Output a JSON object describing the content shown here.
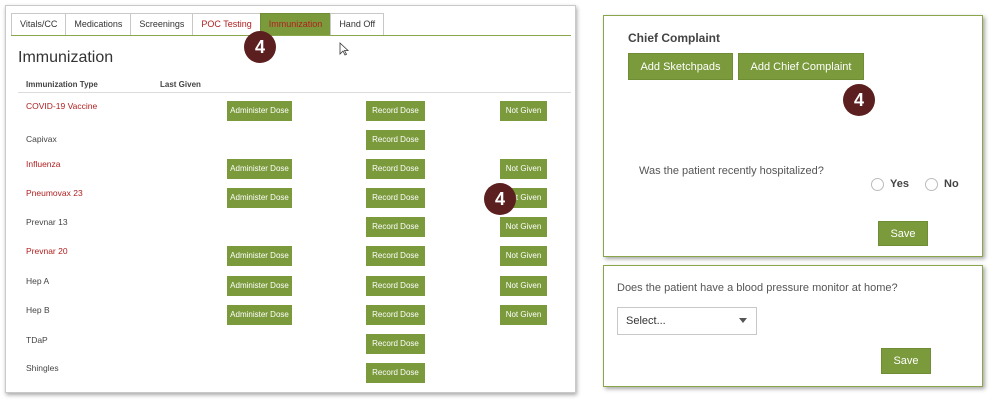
{
  "left": {
    "tabs": [
      "Vitals/CC",
      "Medications",
      "Screenings",
      "POC Testing",
      "Immunization",
      "Hand Off"
    ],
    "heading": "Immunization",
    "col_type": "Immunization Type",
    "col_last": "Last Given",
    "rows": [
      {
        "name": "COVID-19 Vaccine",
        "administer": "Administer Dose",
        "record": "Record Dose",
        "not_given": "Not Given"
      },
      {
        "name": "Capivax",
        "record": "Record Dose"
      },
      {
        "name": "Influenza",
        "administer": "Administer Dose",
        "record": "Record Dose",
        "not_given": "Not Given"
      },
      {
        "name": "Pneumovax 23",
        "administer": "Administer Dose",
        "record": "Record Dose",
        "not_given": "Not Given"
      },
      {
        "name": "Prevnar 13",
        "record": "Record Dose",
        "not_given": "Not Given"
      },
      {
        "name": "Prevnar 20",
        "administer": "Administer Dose",
        "record": "Record Dose",
        "not_given": "Not Given"
      },
      {
        "name": "Hep A",
        "administer": "Administer Dose",
        "record": "Record Dose",
        "not_given": "Not Given"
      },
      {
        "name": "Hep B",
        "administer": "Administer Dose",
        "record": "Record Dose",
        "not_given": "Not Given"
      },
      {
        "name": "TDaP",
        "record": "Record Dose"
      },
      {
        "name": "Shingles",
        "record": "Record Dose"
      }
    ],
    "badge": "4"
  },
  "right": {
    "chief_title": "Chief Complaint",
    "add_sketchpads": "Add Sketchpads",
    "add_chief": "Add Chief Complaint",
    "badge": "4",
    "question1": "Was the patient recently hospitalized?",
    "yes": "Yes",
    "no": "No",
    "save": "Save",
    "question2": "Does the patient have a blood pressure monitor at home?",
    "select_value": "Select...",
    "save2": "Save"
  },
  "colors": {
    "accent_green": "#7a9a3b",
    "link_red": "#b02020",
    "badge_maroon": "#5c1f1f"
  }
}
